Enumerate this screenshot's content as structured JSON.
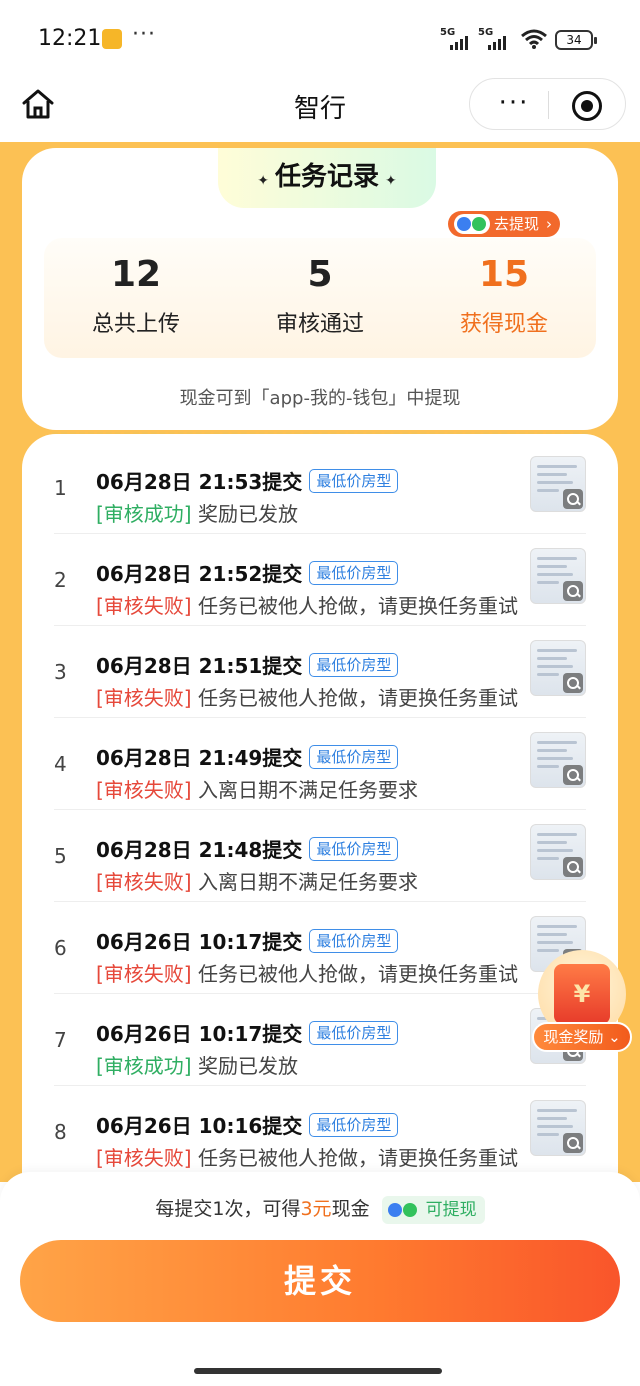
{
  "status_bar": {
    "time": "12:21",
    "more": "···",
    "signal1": "5G",
    "signal2": "5G",
    "battery": "34"
  },
  "nav": {
    "title": "智行",
    "more_icon": "···"
  },
  "summary": {
    "title": "任务记录",
    "star": "✦",
    "withdraw_label": "去提现",
    "withdraw_chevron": "›",
    "stats": [
      {
        "value": "12",
        "label": "总共上传"
      },
      {
        "value": "5",
        "label": "审核通过"
      },
      {
        "value": "15",
        "label": "获得现金"
      }
    ],
    "hint": "现金可到「app-我的-钱包」中提现"
  },
  "tasks": [
    {
      "index": "1",
      "time": "06月28日 21:53提交",
      "tag": "最低价房型",
      "status": "[审核成功]",
      "status_type": "ok",
      "message": "奖励已发放"
    },
    {
      "index": "2",
      "time": "06月28日 21:52提交",
      "tag": "最低价房型",
      "status": "[审核失败]",
      "status_type": "fail",
      "message": "任务已被他人抢做，请更换任务重试"
    },
    {
      "index": "3",
      "time": "06月28日 21:51提交",
      "tag": "最低价房型",
      "status": "[审核失败]",
      "status_type": "fail",
      "message": "任务已被他人抢做，请更换任务重试"
    },
    {
      "index": "4",
      "time": "06月28日 21:49提交",
      "tag": "最低价房型",
      "status": "[审核失败]",
      "status_type": "fail",
      "message": "入离日期不满足任务要求"
    },
    {
      "index": "5",
      "time": "06月28日 21:48提交",
      "tag": "最低价房型",
      "status": "[审核失败]",
      "status_type": "fail",
      "message": "入离日期不满足任务要求"
    },
    {
      "index": "6",
      "time": "06月26日 10:17提交",
      "tag": "最低价房型",
      "status": "[审核失败]",
      "status_type": "fail",
      "message": "任务已被他人抢做，请更换任务重试"
    },
    {
      "index": "7",
      "time": "06月26日 10:17提交",
      "tag": "最低价房型",
      "status": "[审核成功]",
      "status_type": "ok",
      "message": "奖励已发放"
    },
    {
      "index": "8",
      "time": "06月26日 10:16提交",
      "tag": "最低价房型",
      "status": "[审核失败]",
      "status_type": "fail",
      "message": "任务已被他人抢做，请更换任务重试"
    }
  ],
  "reward": {
    "symbol": "¥",
    "label": "现金奖励"
  },
  "bottom": {
    "info_prefix": "每提交1次，可得",
    "amount": "3元",
    "info_suffix": "现金",
    "chip_label": "可提现",
    "submit_label": "提交"
  },
  "colors": {
    "accent": "#f0701e",
    "success": "#2fae62",
    "fail": "#e6483a",
    "tag_blue": "#2f80e0",
    "background": "#fcc154"
  }
}
